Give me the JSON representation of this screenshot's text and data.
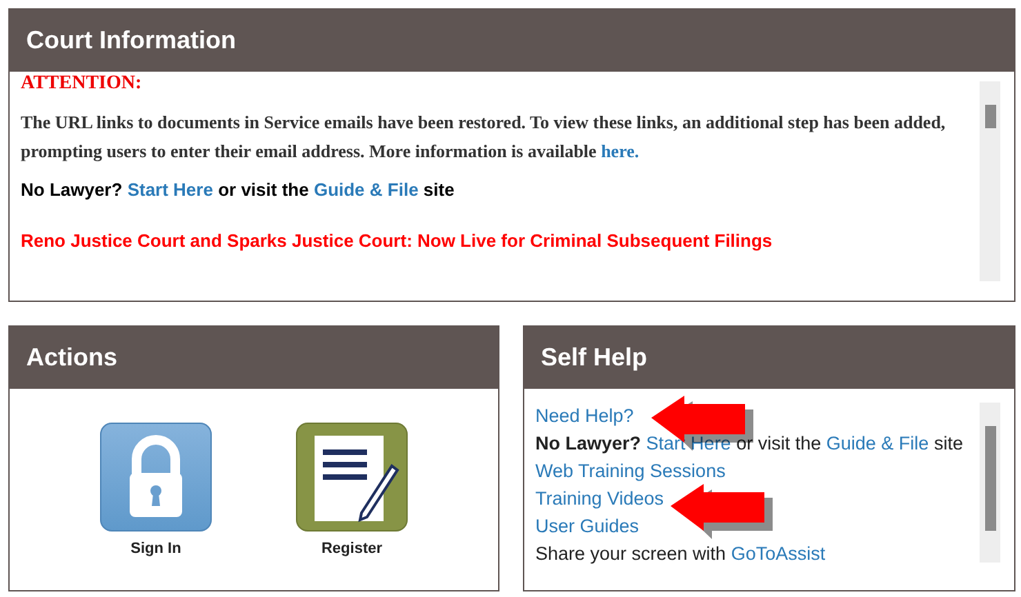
{
  "court_information": {
    "title": "Court Information",
    "notices": [
      {
        "kind": "heading",
        "parts": [
          {
            "text": "ATTENTION:",
            "kind": "text"
          }
        ]
      },
      {
        "kind": "paragraph",
        "parts": [
          {
            "text": "The URL links to documents in Service emails have been restored. To view these links, an additional step has been added, prompting users to enter their email address. More information is available ",
            "kind": "text"
          },
          {
            "text": "here.",
            "kind": "link"
          }
        ]
      },
      {
        "kind": "line",
        "parts": [
          {
            "text": "No Lawyer?",
            "kind": "text"
          },
          {
            "text": "Start Here",
            "kind": "link"
          },
          {
            "text": "or visit the",
            "kind": "text"
          },
          {
            "text": "Guide & File",
            "kind": "link"
          },
          {
            "text": "site",
            "kind": "text"
          }
        ]
      },
      {
        "kind": "alert",
        "parts": [
          {
            "text": "Reno Justice Court and Sparks Justice Court: Now Live for Criminal Subsequent Filings",
            "kind": "text"
          }
        ]
      }
    ]
  },
  "actions": {
    "title": "Actions",
    "items": [
      {
        "label": "Sign In",
        "kind": "lock"
      },
      {
        "label": "Register",
        "kind": "document"
      }
    ]
  },
  "self_help": {
    "title": "Self Help",
    "lines": [
      [
        {
          "text": "Need Help?",
          "kind": "link"
        }
      ],
      [
        {
          "text": "No Lawyer?",
          "kind": "bold"
        },
        {
          "text": "Start Here",
          "kind": "link"
        },
        {
          "text": "or visit the",
          "kind": "text"
        },
        {
          "text": "Guide & File",
          "kind": "link"
        },
        {
          "text": "site",
          "kind": "text"
        }
      ],
      [
        {
          "text": "Web Training Sessions",
          "kind": "link"
        }
      ],
      [
        {
          "text": "Training Videos",
          "kind": "link"
        }
      ],
      [
        {
          "text": "User Guides",
          "kind": "link"
        }
      ],
      [
        {
          "text": "Share your screen with",
          "kind": "text"
        },
        {
          "text": "GoToAssist",
          "kind": "link"
        }
      ]
    ]
  }
}
